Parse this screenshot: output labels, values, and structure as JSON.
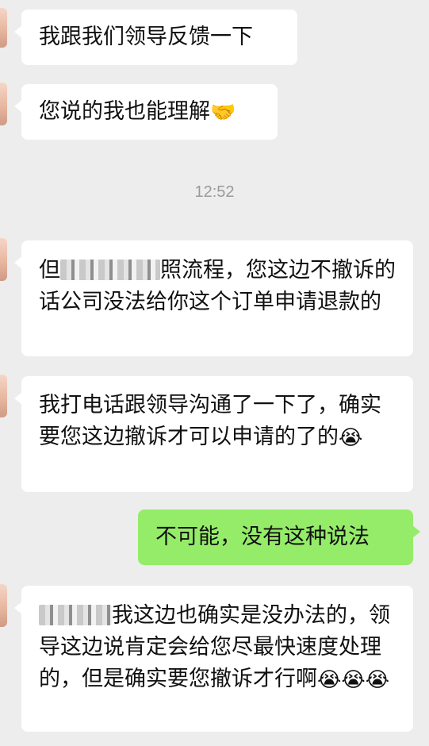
{
  "timestamp": "12:52",
  "messages": [
    {
      "text": "我跟我们领导反馈一下",
      "emoji": "",
      "side": "in"
    },
    {
      "text": "您说的我也能理解",
      "emoji": "🤝",
      "side": "in"
    },
    {
      "text_before_redaction": "但",
      "redaction": "redacted",
      "text_after_redaction": "照流程，您这边不撤诉的话公司没法给你这个订单申请退款的",
      "side": "in"
    },
    {
      "text": "我打电话跟领导沟通了一下了，确实要您这边撤诉才可以申请的了的",
      "emoji": "😭",
      "side": "in"
    },
    {
      "text": "不可能，没有这种说法",
      "emoji": "",
      "side": "out"
    },
    {
      "redaction": "redacted",
      "text_after_redaction": "我这边也确实是没办法的，领导这边说肯定会给您尽最快速度处理的，但是确实要您撤诉才行啊",
      "emoji": "😭😭😭",
      "side": "in"
    }
  ],
  "icons": {
    "avatar": "contact-avatar"
  },
  "colors": {
    "background": "#ededed",
    "incoming_bubble": "#ffffff",
    "outgoing_bubble": "#95ec69",
    "text": "#111111",
    "timestamp": "#9a9a9a"
  }
}
